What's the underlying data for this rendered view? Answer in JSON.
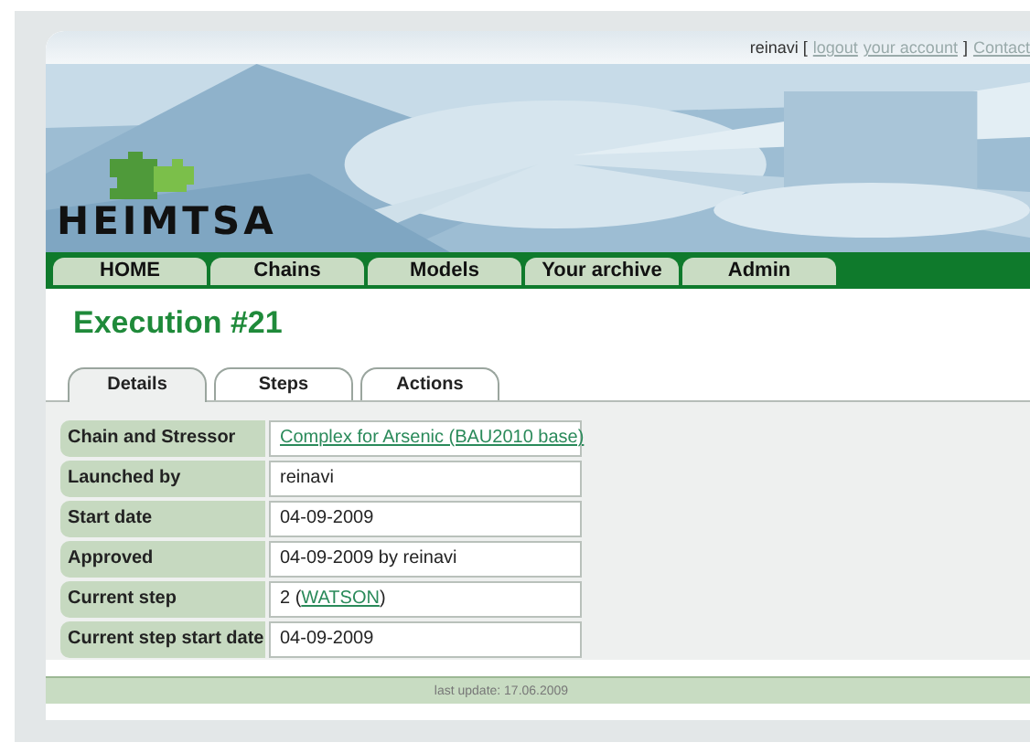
{
  "header": {
    "user": "reinavi [",
    "links": [
      "logout",
      "your account"
    ],
    "close": "]",
    "contact": "Contact"
  },
  "logo": {
    "text": "HEIMTSA"
  },
  "nav": [
    "HOME",
    "Chains",
    "Models",
    "Your archive",
    "Admin"
  ],
  "title": "Execution #21",
  "tabs": [
    {
      "label": "Details",
      "selected": true
    },
    {
      "label": "Steps",
      "selected": false
    },
    {
      "label": "Actions",
      "selected": false
    }
  ],
  "rows": [
    {
      "label": "Chain and Stressor",
      "kind": "link",
      "link": "Complex for Arsenic (BAU2010 base)"
    },
    {
      "label": "Launched by",
      "kind": "text",
      "value": "reinavi"
    },
    {
      "label": "Start date",
      "kind": "text",
      "value": "04-09-2009"
    },
    {
      "label": "Approved",
      "kind": "text",
      "value": "04-09-2009 by reinavi"
    },
    {
      "label": "Current step",
      "kind": "mixed",
      "prefix": "2 (",
      "link": "WATSON",
      "suffix": ")"
    },
    {
      "label": "Current step start date",
      "kind": "text",
      "value": "04-09-2009"
    }
  ],
  "footer": "last update: 17.06.2009"
}
